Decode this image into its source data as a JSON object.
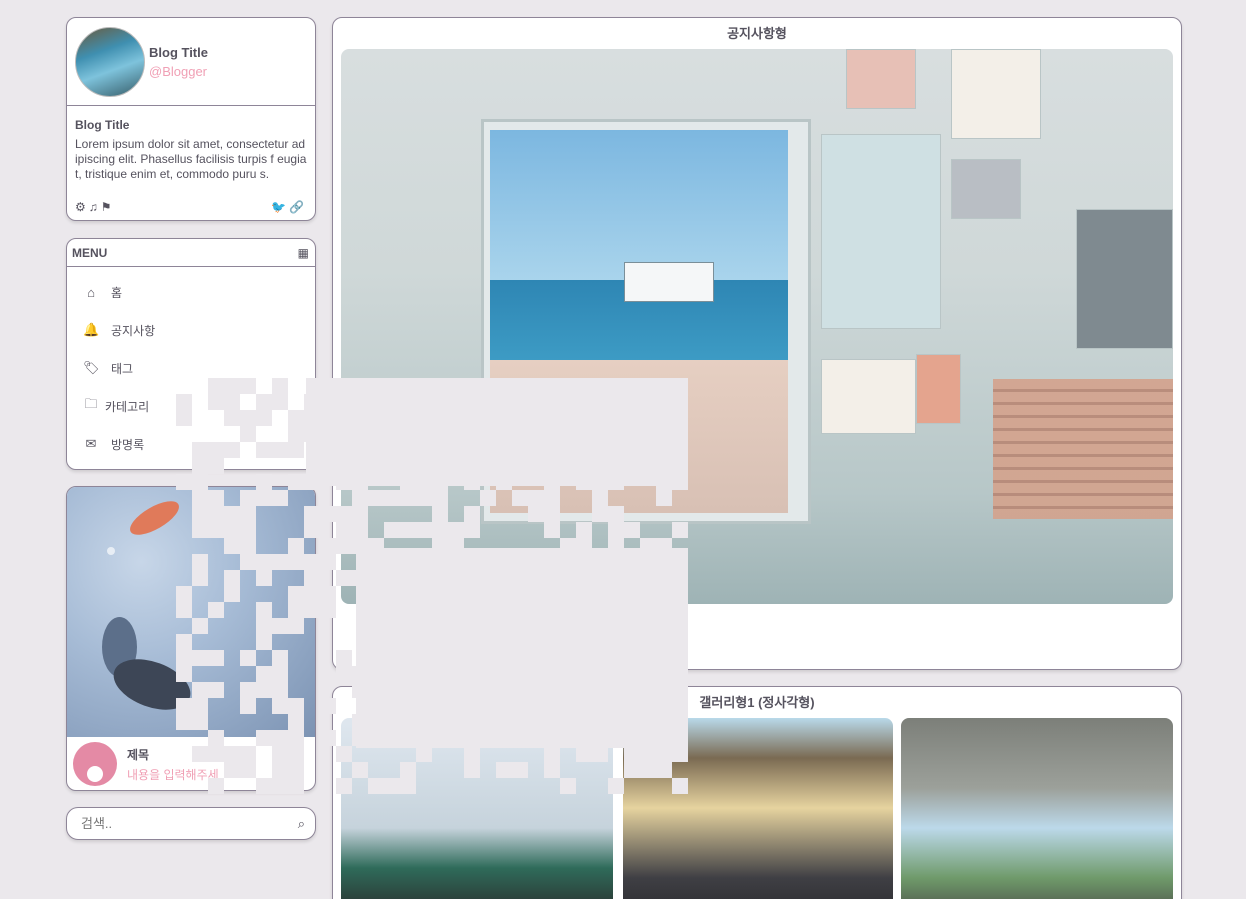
{
  "profile": {
    "blog_title": "Blog Title",
    "blogger": "@Blogger",
    "title": "Blog Title",
    "description": "Lorem ipsum dolor sit amet, consectetur adipiscing elit. Phasellus facilisis turpis f eugiat, tristique enim et, commodo puru s.",
    "icons_left": [
      "gear-icon",
      "music-icon",
      "flag-icon"
    ],
    "icons_right": [
      "twitter-icon",
      "link-icon"
    ]
  },
  "menu": {
    "header": "MENU",
    "items": [
      {
        "label": "홈",
        "icon": "home-icon"
      },
      {
        "label": "공지사항",
        "icon": "bell-icon"
      },
      {
        "label": "태그",
        "icon": "tag-icon"
      },
      {
        "label": "카테고리",
        "icon": "folder-icon"
      },
      {
        "label": "방명록",
        "icon": "mail-icon"
      }
    ]
  },
  "post_card": {
    "title": "제목",
    "subtitle": "내용을 입력해주세"
  },
  "search": {
    "placeholder": "검색.."
  },
  "notice": {
    "title": "공지사항형"
  },
  "gallery": {
    "title": "갤러리형1 (정사각형)"
  },
  "colors": {
    "background": "#ebe8ec",
    "border": "#8e8598",
    "accent_pink": "#f0a0b5"
  }
}
